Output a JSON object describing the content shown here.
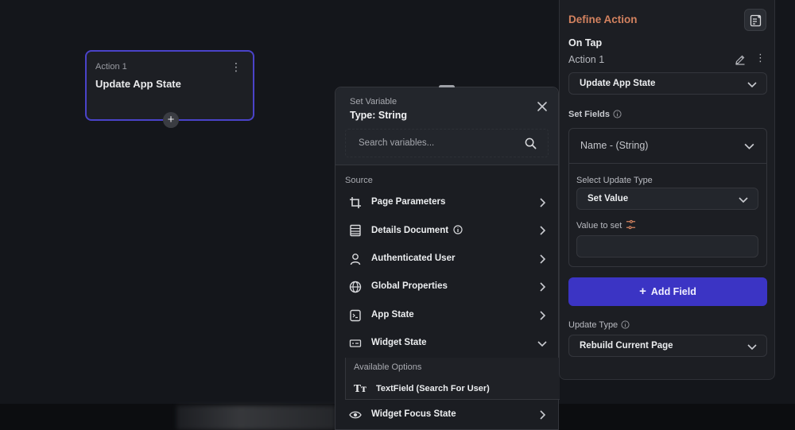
{
  "canvas_node": {
    "label": "Action 1",
    "title": "Update App State",
    "menu": "⋮",
    "add": "+"
  },
  "variable_panel": {
    "subtitle": "Set Variable",
    "title": "Type: String",
    "search_placeholder": "Search variables...",
    "section_label": "Source",
    "rows": [
      {
        "label": "Page Parameters",
        "icon": "crop-icon"
      },
      {
        "label": "Details Document",
        "icon": "document-icon"
      },
      {
        "label": "Authenticated User",
        "icon": "user-icon"
      },
      {
        "label": "Global Properties",
        "icon": "globe-icon"
      },
      {
        "label": "App State",
        "icon": "app-state-icon"
      },
      {
        "label": "Widget State",
        "icon": "widget-icon"
      },
      {
        "label": "Widget Focus State",
        "icon": "eye-icon"
      }
    ],
    "available_options_label": "Available Options",
    "option_icon": "Tт",
    "option_item": "TextField (Search For User)"
  },
  "define_action": {
    "title": "Define Action",
    "trigger": "On Tap",
    "action_label": "Action 1",
    "action_type": "Update App State",
    "set_fields_label": "Set Fields",
    "field_name": "Name - (String)",
    "select_update_type_label": "Select Update Type",
    "update_type_value": "Set Value",
    "value_to_set_label": "Value to set",
    "add_field": "Add Field",
    "add_field_plus": "+",
    "update_type_label": "Update Type",
    "update_type_selection": "Rebuild Current Page"
  },
  "colors": {
    "accent": "#3b34c4",
    "title_orange": "#d3825f",
    "node_border": "#4a43c9"
  }
}
